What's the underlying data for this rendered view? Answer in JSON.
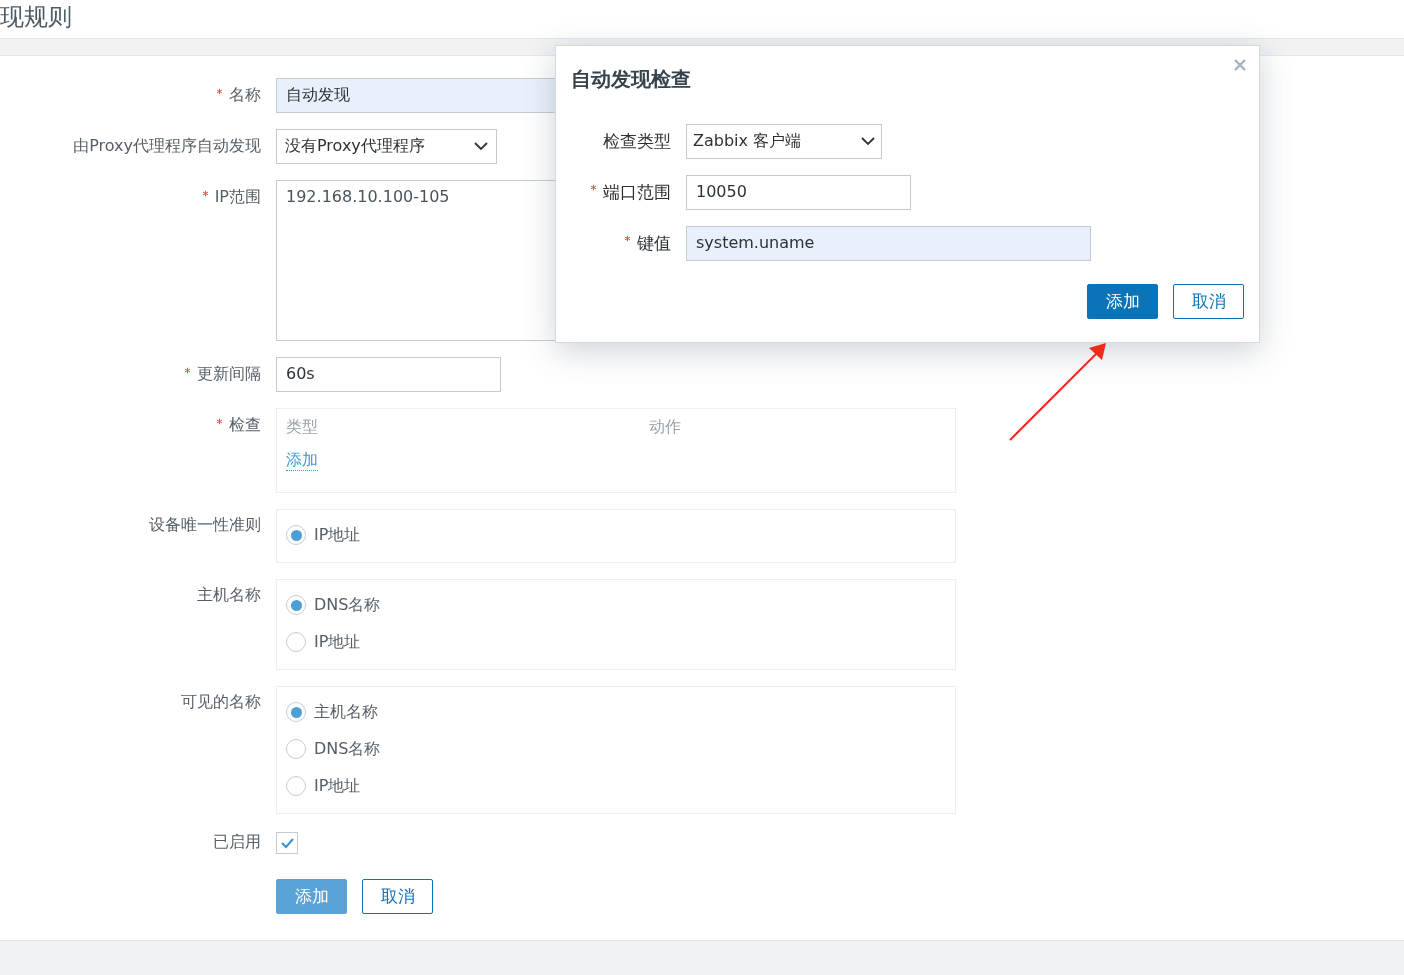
{
  "page": {
    "title": "现规则"
  },
  "form": {
    "fields": [
      {
        "kind": "text",
        "label": "名称",
        "required": true,
        "value": "自动发现",
        "autofilled": true
      },
      {
        "kind": "select",
        "label": "由Proxy代理程序自动发现",
        "required": false,
        "value": "没有Proxy代理程序"
      },
      {
        "kind": "textarea",
        "label": "IP范围",
        "required": true,
        "value": "192.168.10.100-105"
      },
      {
        "kind": "text",
        "label": "更新间隔",
        "required": true,
        "value": "60s",
        "autofilled": false
      },
      {
        "kind": "checks",
        "label": "检查",
        "required": true,
        "columns": [
          "类型",
          "动作"
        ],
        "link": "添加"
      },
      {
        "kind": "radio",
        "label": "设备唯一性准则",
        "required": false,
        "options": [
          {
            "label": "IP地址",
            "selected": true
          }
        ]
      },
      {
        "kind": "radio",
        "label": "主机名称",
        "required": false,
        "options": [
          {
            "label": "DNS名称",
            "selected": true
          },
          {
            "label": "IP地址",
            "selected": false
          }
        ]
      },
      {
        "kind": "radio",
        "label": "可见的名称",
        "required": false,
        "options": [
          {
            "label": "主机名称",
            "selected": true
          },
          {
            "label": "DNS名称",
            "selected": false
          },
          {
            "label": "IP地址",
            "selected": false
          }
        ]
      },
      {
        "kind": "checkbox",
        "label": "已启用",
        "required": false,
        "checked": true
      }
    ],
    "buttons": [
      "添加",
      "取消"
    ]
  },
  "dialog": {
    "title": "自动发现检查",
    "fields": [
      {
        "kind": "select",
        "label": "检查类型",
        "required": false,
        "value": "Zabbix 客户端"
      },
      {
        "kind": "text",
        "label": "端口范围",
        "required": true,
        "value": "10050",
        "autofilled": false,
        "wide": false
      },
      {
        "kind": "text",
        "label": "键值",
        "required": true,
        "value": "system.uname",
        "autofilled": true,
        "wide": true
      }
    ],
    "buttons": [
      "添加",
      "取消"
    ]
  }
}
